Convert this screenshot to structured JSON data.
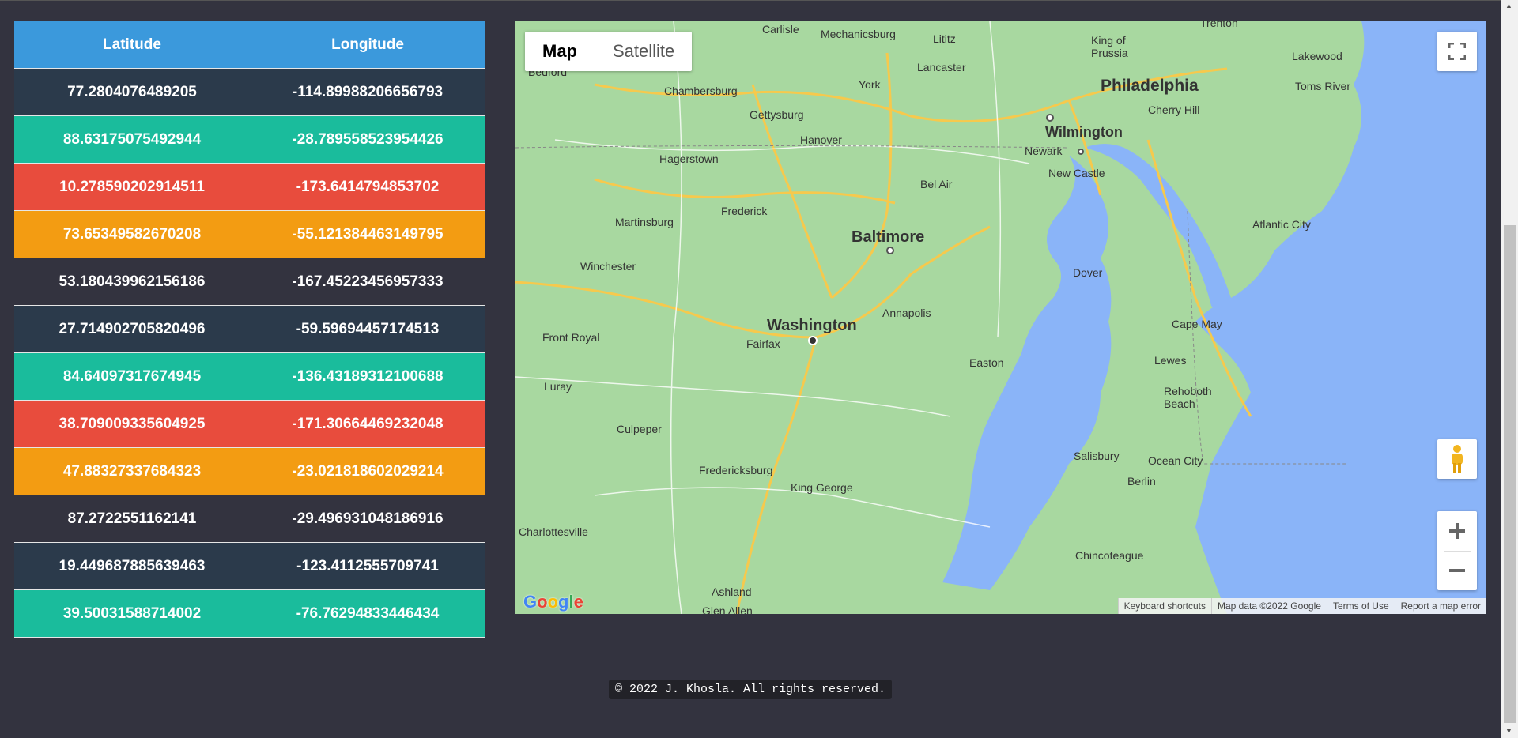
{
  "table": {
    "headers": {
      "latitude": "Latitude",
      "longitude": "Longitude"
    },
    "rows": [
      {
        "lat": "77.2804076489205",
        "lon": "-114.89988206656793",
        "color": "#2b3a4b"
      },
      {
        "lat": "88.63175075492944",
        "lon": "-28.789558523954426",
        "color": "#1abc9c"
      },
      {
        "lat": "10.278590202914511",
        "lon": "-173.6414794853702",
        "color": "#e84c3d"
      },
      {
        "lat": "73.65349582670208",
        "lon": "-55.12138446314979 5",
        "color": "#f39c12"
      },
      {
        "lat": "53.180439962156186",
        "lon": "-167.45223456957333",
        "color": "#33333f"
      },
      {
        "lat": "27.714902705820496",
        "lon": "-59.59694457174513",
        "color": "#2b3a4b"
      },
      {
        "lat": "84.64097317674945",
        "lon": "-136.43189312100688",
        "color": "#1abc9c"
      },
      {
        "lat": "38.709009335604925",
        "lon": "-171.30664469232048",
        "color": "#e84c3d"
      },
      {
        "lat": "47.88327337684323",
        "lon": "-23.021818602029214",
        "color": "#f39c12"
      },
      {
        "lat": "87.2722551162141",
        "lon": "-29.496931048186916",
        "color": "#33333f"
      },
      {
        "lat": "19.449687885639463",
        "lon": "-123.4112555709741",
        "color": "#2b3a4b"
      },
      {
        "lat": "39.50031588714002",
        "lon": "-76.76294833446434",
        "color": "#1abc9c"
      }
    ]
  },
  "map": {
    "type_control": {
      "map": "Map",
      "satellite": "Satellite",
      "selected": "Map"
    },
    "logo": "Google",
    "attribution": [
      "Keyboard shortcuts",
      "Map data ©2022 Google",
      "Terms of Use",
      "Report a map error"
    ],
    "places": {
      "philadelphia": "Philadelphia",
      "baltimore": "Baltimore",
      "washington": "Washington",
      "wilmington": "Wilmington",
      "annapolis": "Annapolis",
      "dover": "Dover",
      "atlantic_city": "Atlantic City",
      "cape_may": "Cape May",
      "lewes": "Lewes",
      "rehoboth": "Rehoboth Beach",
      "salisbury": "Salisbury",
      "ocean_city": "Ocean City",
      "berlin": "Berlin",
      "chincoteague": "Chincoteague",
      "fredericksburg": "Fredericksburg",
      "king_george": "King George",
      "charlottesville": "Charlottesville",
      "culpeper": "Culpeper",
      "luray": "Luray",
      "front_royal": "Front Royal",
      "winchester": "Winchester",
      "martinsburg": "Martinsburg",
      "hagerstown": "Hagerstown",
      "frederick": "Frederick",
      "gettysburg": "Gettysburg",
      "hanover": "Hanover",
      "york": "York",
      "lancaster": "Lancaster",
      "chambersburg": "Chambersburg",
      "carlisle": "Carlisle",
      "mechanicsburg": "Mechanicsburg",
      "lititz": "Lititz",
      "king_of_prussia": "King of Prussia",
      "trenton": "Trenton",
      "lakewood": "Lakewood",
      "toms_river": "Toms River",
      "cherry_hill": "Cherry Hill",
      "newark": "Newark",
      "new_castle": "New Castle",
      "bel_air": "Bel Air",
      "easton": "Easton",
      "fairfax": "Fairfax",
      "ashland": "Ashland",
      "bedford": "Bedford",
      "glen_allen": "Glen Allen"
    }
  },
  "footer": "© 2022 J. Khosla. All rights reserved."
}
